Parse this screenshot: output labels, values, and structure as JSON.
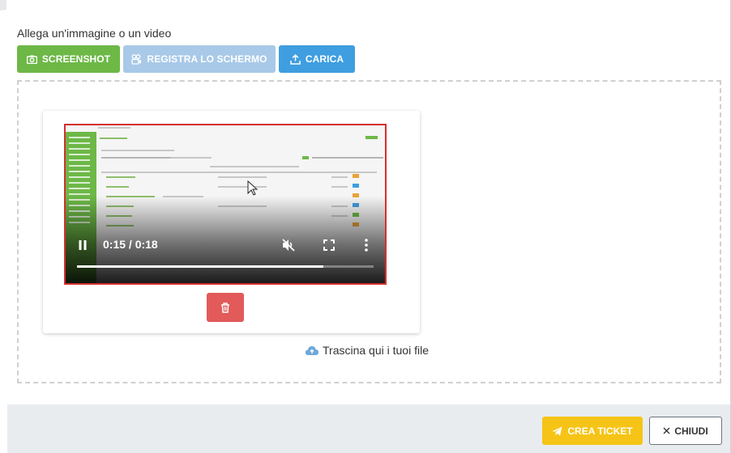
{
  "modal": {
    "attach_label": "Allega un'immagine o un video",
    "buttons": {
      "screenshot": "SCREENSHOT",
      "record": "REGISTRA LO SCHERMO",
      "upload": "CARICA"
    },
    "video": {
      "time": "0:15 / 0:18",
      "progress_fraction": 0.83
    },
    "dropzone_text": "Trascina qui i tuoi file"
  },
  "footer": {
    "create_label": "CREA TICKET",
    "close_label": "CHIUDI"
  },
  "colors": {
    "green": "#6db847",
    "light_blue": "#a8c9e8",
    "blue": "#3f9ee0",
    "red": "#e25a5a",
    "yellow": "#f6c416"
  },
  "icons": {
    "screenshot": "camera-icon",
    "record": "record-screen-icon",
    "upload": "upload-icon",
    "delete": "trash-icon",
    "dropzone": "cloud-upload-icon",
    "create": "paper-plane-icon",
    "close": "close-icon"
  }
}
